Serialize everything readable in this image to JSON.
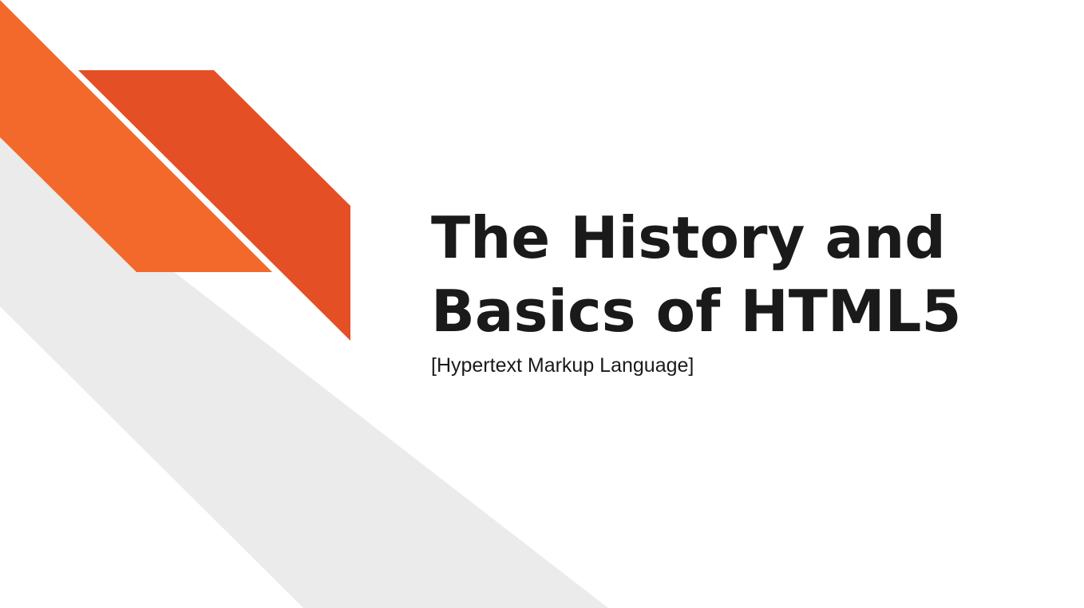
{
  "slide": {
    "title_line_1": "The History and",
    "title_line_2": "Basics of HTML5",
    "subtitle": "[Hypertext Markup Language]"
  },
  "colors": {
    "background": "#ffffff",
    "gray_band": "#ebebeb",
    "orange_light": "#f2692b",
    "orange_dark": "#e44f26",
    "text": "#1a1a1a"
  }
}
